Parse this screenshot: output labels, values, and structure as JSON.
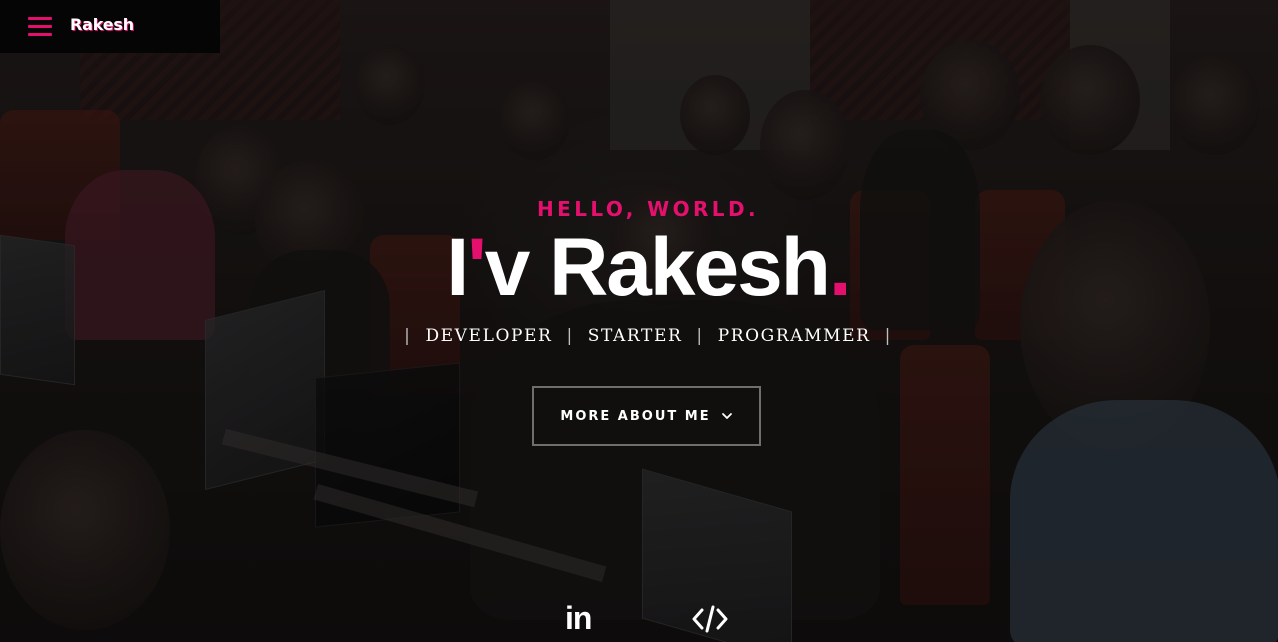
{
  "navbar": {
    "brand": "Rakesh",
    "menu_icon": "hamburger-icon",
    "accent_color": "#e5106d"
  },
  "hero": {
    "greeting": "HELLO, WORLD.",
    "headline_prefix": "I",
    "headline_apostrophe": "'",
    "headline_rest": "v Rakesh",
    "headline_dot": ".",
    "roles": [
      "DEVELOPER",
      "STARTER",
      "PROGRAMMER"
    ],
    "role_separator": "|",
    "cta_label": "MORE ABOUT ME",
    "cta_icon": "chevron-down-icon",
    "background_image": "students working on laptops in a lecture hall"
  },
  "socials": [
    {
      "name": "linkedin",
      "text": "in",
      "icon": "linkedin-icon"
    },
    {
      "name": "code",
      "icon": "code-icon"
    }
  ],
  "colors": {
    "accent": "#e5106d",
    "text": "#ffffff",
    "topbar_bg": "#050505",
    "button_border": "#6e6e6e"
  }
}
